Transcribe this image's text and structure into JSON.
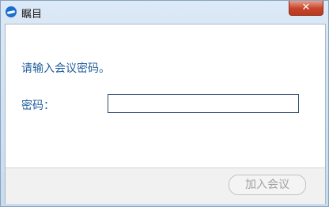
{
  "window": {
    "title": "瞩目",
    "close_symbol": "✕"
  },
  "dialog": {
    "message": "请输入会议密码。",
    "password_label": "密码：",
    "password_value": "",
    "join_button_label": "加入会议"
  },
  "icons": {
    "app_icon": "zhumu-logo-icon",
    "close_icon": "close-icon"
  },
  "colors": {
    "label_text": "#1f5d9e",
    "close_button": "#c7432a",
    "disabled_text": "#a3a3a3"
  }
}
